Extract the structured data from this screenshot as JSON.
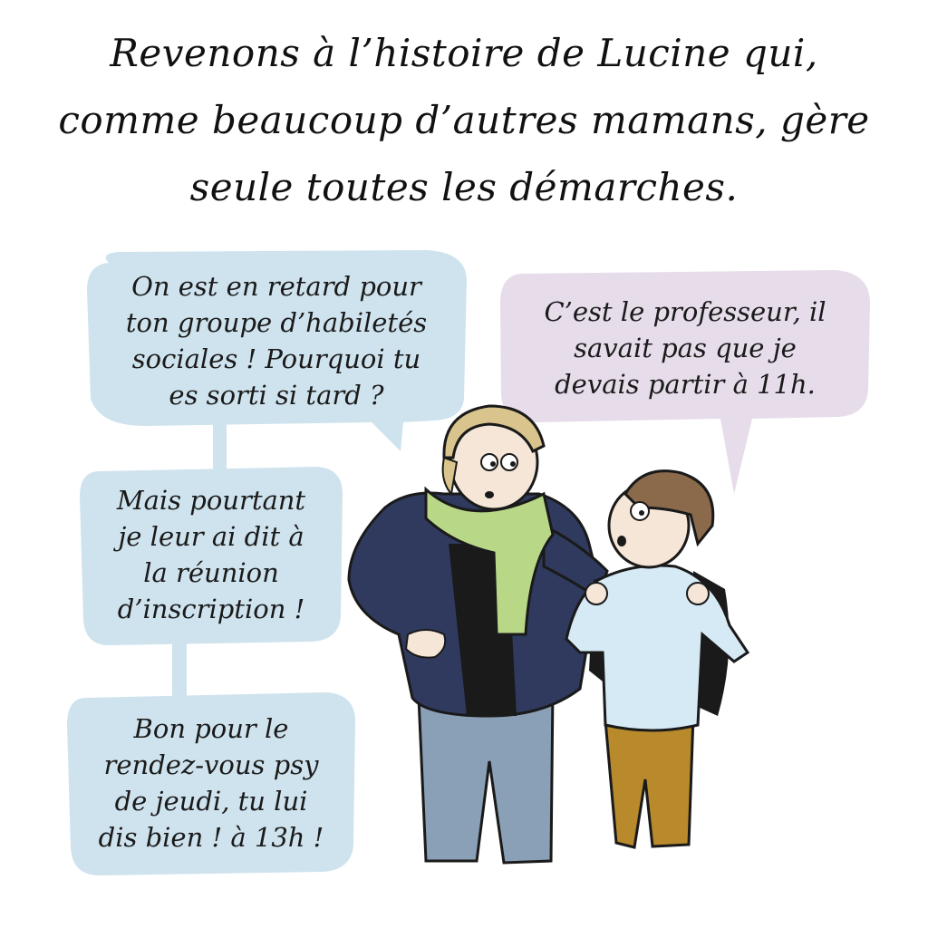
{
  "caption": {
    "line1": "Revenons à l’histoire de Lucine qui,",
    "line2": "comme beaucoup d’autres mamans, gère",
    "line3": "seule toutes les démarches."
  },
  "bubbles": {
    "mother_1": {
      "line1": "On est en retard pour",
      "line2": "ton groupe d’habiletés",
      "line3": "sociales ! Pourquoi tu",
      "line4": "es sorti si tard ?"
    },
    "mother_2": {
      "line1": "Mais pourtant",
      "line2": "je leur ai dit à",
      "line3": "la réunion",
      "line4": "d’inscription !"
    },
    "mother_3": {
      "line1": "Bon pour le",
      "line2": "rendez-vous psy",
      "line3": "de jeudi, tu lui",
      "line4": "dis bien ! à 13h !"
    },
    "son_1": {
      "line1": "C’est le professeur, il",
      "line2": "savait pas que je",
      "line3": "devais partir à 11h."
    }
  },
  "colors": {
    "bubble_blue": "#cfe3ee",
    "bubble_purple": "#e6dcea",
    "mother_jacket": "#2f3a5e",
    "mother_scarf": "#b8d888",
    "mother_hair": "#d8c48c",
    "mother_pants": "#8aa0b6",
    "son_sweater": "#d6eaf6",
    "son_hair": "#8a6a4a",
    "son_pants": "#b88a2c",
    "skin": "#f6e6d8"
  }
}
